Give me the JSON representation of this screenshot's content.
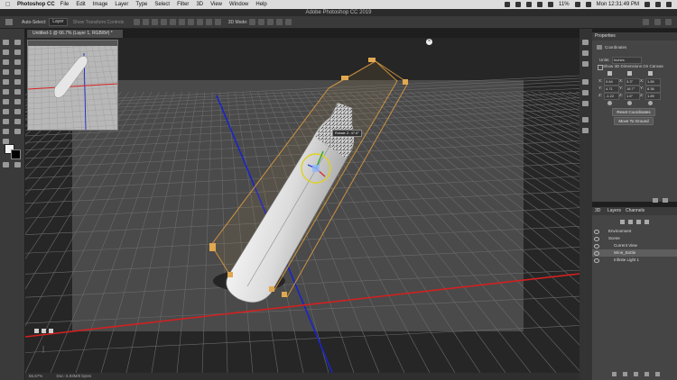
{
  "menubar": {
    "app_name": "Photoshop CC",
    "items": [
      "File",
      "Edit",
      "Image",
      "Layer",
      "Type",
      "Select",
      "Filter",
      "3D",
      "View",
      "Window",
      "Help"
    ],
    "battery": "11%",
    "clock": "Mon 12:31:49 PM"
  },
  "titlebar": {
    "title": "Adobe Photoshop CC 2019"
  },
  "options": {
    "auto_select_label": "Auto-Select:",
    "auto_select_value": "Layer",
    "transform_label": "Show Transform Controls",
    "mode_label": "3D Mode:"
  },
  "document": {
    "tab_title": "Untitled-1 @ 66.7% (Layer 1, RGB/8#) *",
    "tooltip": "Rotate Z: 47.6°",
    "zoom": "66.67%",
    "doc_info": "Doc: 5.93M/0 bytes"
  },
  "properties": {
    "tab_label": "Properties",
    "section_title": "Coordinates",
    "units_label": "Units:",
    "units_value": "Inches",
    "show_3d_dimensions": "Show 3D Dimensions On Canvas",
    "x_label": "X:",
    "y_label": "Y:",
    "z_label": "Z:",
    "pos_x": "0.64",
    "pos_y": "4.71",
    "pos_z": "-1.22",
    "rot_x": "3.3°",
    "rot_y": "18.7°",
    "rot_z": "1.6°",
    "scale_x": "1.89",
    "scale_y": "8.36",
    "scale_z": "1.89",
    "reset_button": "Reset Coordinates",
    "move_ground_button": "Move To Ground"
  },
  "panel3d": {
    "tabs": [
      "3D",
      "Layers",
      "Channels"
    ],
    "items": [
      {
        "label": "Environment"
      },
      {
        "label": "Scene"
      },
      {
        "label": "Current View"
      },
      {
        "label": "Wine_Bottle"
      },
      {
        "label": "Infinite Light 1"
      }
    ]
  },
  "colors": {
    "ground_axis_x": "#d32020",
    "ground_axis_z": "#1a24c8",
    "bounding_box": "#e0a040",
    "panel": "#454545"
  }
}
